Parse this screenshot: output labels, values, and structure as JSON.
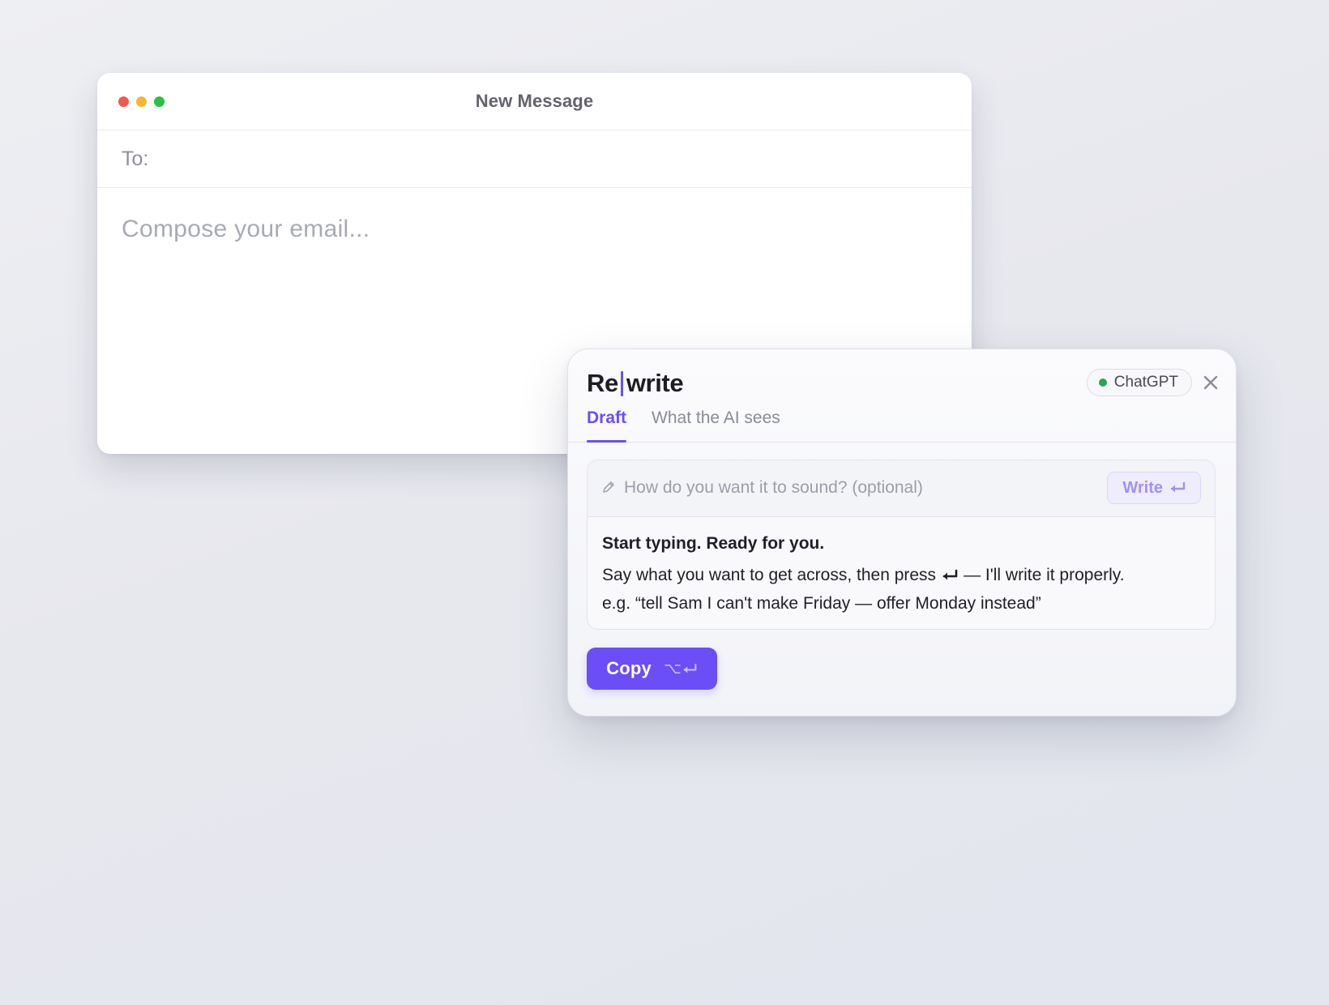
{
  "mail": {
    "window_title": "New Message",
    "to_label": "To:",
    "body_placeholder": "Compose your email..."
  },
  "rewrite": {
    "brand_prefix": "Re",
    "brand_suffix": "write",
    "model_badge": "ChatGPT",
    "tabs": [
      {
        "label": "Draft",
        "active": true
      },
      {
        "label": "What the AI sees",
        "active": false
      }
    ],
    "tone_placeholder": "How do you want it to sound? (optional)",
    "write_button": "Write",
    "hint": {
      "title": "Start typing. Ready for you.",
      "line1_before": "Say what you want to get across, then press",
      "line1_after": "— I'll write it properly.",
      "example": "e.g. “tell Sam I can't make Friday — offer Monday instead”"
    },
    "copy_button": "Copy",
    "copy_shortcut_modifier": "⌥"
  },
  "colors": {
    "accent": "#6b4ef5",
    "status_dot": "#29a55a",
    "traffic_red": "#ee5a52",
    "traffic_yellow": "#f3b830",
    "traffic_green": "#2bc140"
  },
  "icons": [
    "pencil-icon",
    "close-icon",
    "return-key-icon",
    "option-key-icon"
  ]
}
